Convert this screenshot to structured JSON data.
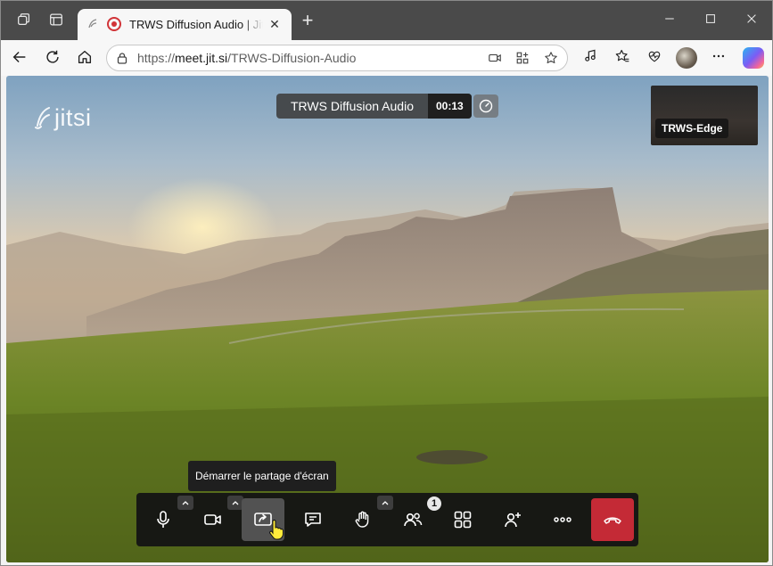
{
  "browser": {
    "tab": {
      "title": "TRWS Diffusion Audio | Jitsi Meet",
      "close_label": "✕"
    },
    "new_tab_label": "+",
    "url": {
      "scheme": "https://",
      "host": "meet.jit.si",
      "path": "/TRWS-Diffusion-Audio"
    }
  },
  "meeting": {
    "brand": "jitsi",
    "title": "TRWS Diffusion Audio",
    "timer": "00:13",
    "participant_thumbnail": "TRWS-Edge",
    "tooltip": "Démarrer le partage d'écran",
    "participants_count": "1"
  },
  "colors": {
    "accent_hangup": "#c42a36",
    "toolbar": "#141414",
    "tab_strip": "#4a4a4a"
  },
  "icons": {
    "toolbox": [
      "microphone-icon",
      "camera-icon",
      "screen-share-icon",
      "chat-icon",
      "raise-hand-icon",
      "participants-icon",
      "tile-view-icon",
      "invite-icon",
      "more-icon",
      "hangup-icon"
    ]
  }
}
